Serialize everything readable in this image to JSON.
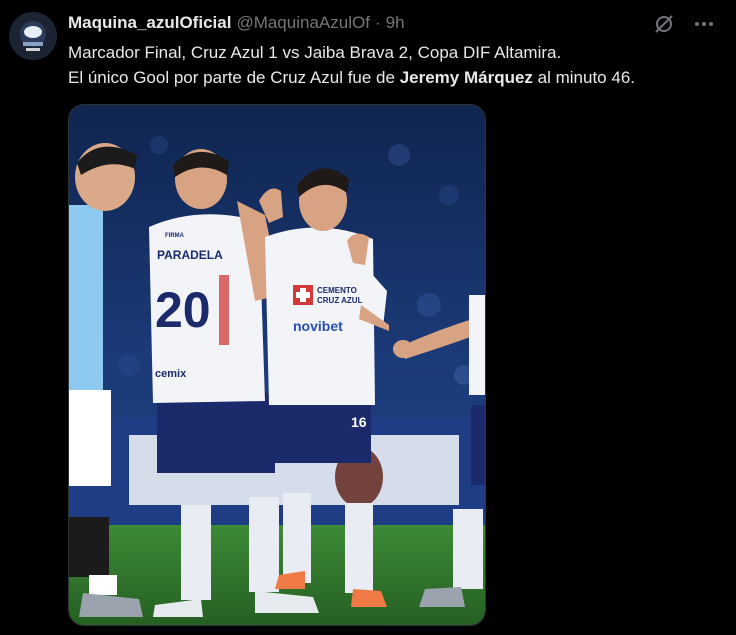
{
  "tweet": {
    "display_name": "Maquina_azulOficial",
    "handle": "@MaquinaAzulOf",
    "separator": "·",
    "time": "9h",
    "text_line1": "Marcador Final, Cruz Azul 1 vs Jaiba Brava 2, Copa DIF Altamira.",
    "text_line2_prefix": "El único Gool por parte de Cruz Azul fue de ",
    "text_line2_bold": "Jeremy Márquez",
    "text_line2_suffix": " al minuto 46."
  },
  "icons": {
    "grok": "grok-icon",
    "more": "more-icon"
  },
  "media": {
    "player_name": "PARADELA",
    "player_number": "20",
    "sponsor": "novibet",
    "crest_text_1": "CEMENTO",
    "crest_text_2": "CRUZ AZUL",
    "shirt_brand": "FIRMA",
    "shorts_number": "16",
    "shorts_brand": "cemix"
  },
  "colors": {
    "background": "#000000",
    "text": "#e7e9ea",
    "muted": "#71767b",
    "kit_white": "#f2f4f8",
    "kit_navy": "#1b2a6b",
    "opponent_blue": "#8ec9ef",
    "grass": "#2f7a2c"
  }
}
